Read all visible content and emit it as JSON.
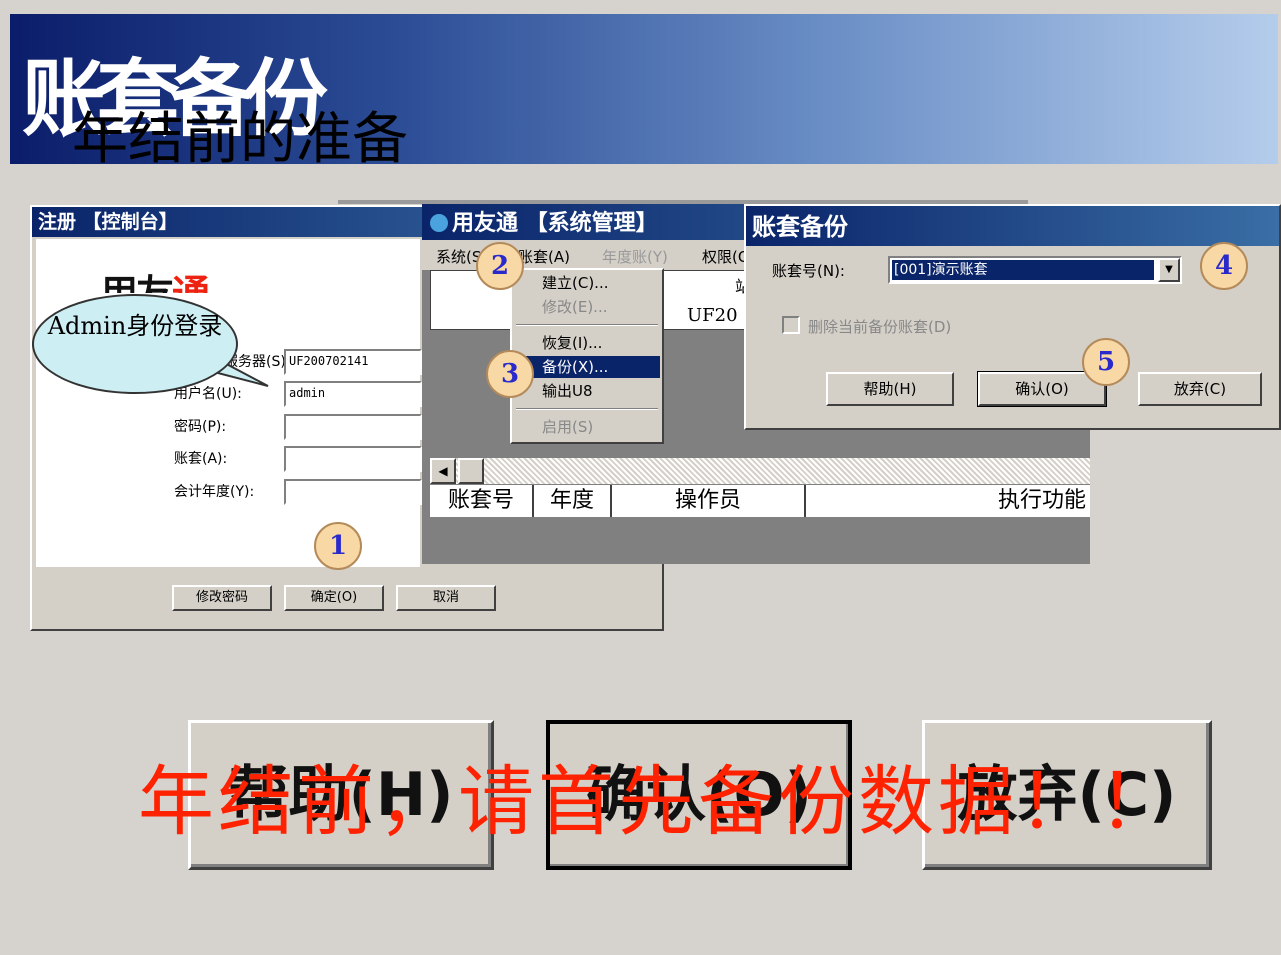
{
  "banner": {
    "title": "账套备份",
    "subtitle": "年结前的准备"
  },
  "login": {
    "title": "注册 【控制台】",
    "logo_prefix": "用友",
    "logo_red": "通",
    "fields": [
      {
        "label": "服务器(S):",
        "value": "UF200702141"
      },
      {
        "label": "用户名(U):",
        "value": "admin"
      },
      {
        "label": "密码(P):",
        "value": ""
      },
      {
        "label": "账套(A):",
        "value": ""
      },
      {
        "label": "会计年度(Y):",
        "value": ""
      }
    ],
    "buttons": {
      "change_password": "修改密码",
      "ok": "确定(O)",
      "cancel": "取消"
    }
  },
  "sysmgr": {
    "title": "用友通 【系统管理】",
    "menu": {
      "system": "系统(S)",
      "account": "账套(A)",
      "year": "年度账(Y)",
      "permission": "权限(O)"
    },
    "grid_cell": "UF20",
    "grid_cell_top": "站",
    "columns": [
      "账套号",
      "年度",
      "操作员",
      "执行功能"
    ]
  },
  "dropdown": {
    "items": [
      {
        "label": "建立(C)...",
        "disabled": false
      },
      {
        "label": "修改(E)...",
        "disabled": true
      },
      {
        "label": "恢复(I)...",
        "disabled": false
      },
      {
        "label": "备份(X)...",
        "disabled": false,
        "selected": true
      },
      {
        "label": "输出U8",
        "disabled": false
      },
      {
        "label": "启用(S)",
        "disabled": true
      }
    ]
  },
  "backup": {
    "title": "账套备份",
    "account_label": "账套号(N):",
    "account_value": "[001]演示账套",
    "delete_label": "删除当前备份账套(D)",
    "buttons": {
      "help": "帮助(H)",
      "confirm": "确认(O)",
      "discard": "放弃(C)"
    }
  },
  "callouts": {
    "bubble": "Admin身份登录",
    "numbers": [
      "1",
      "2",
      "3",
      "4",
      "5"
    ]
  },
  "big_buttons": {
    "help": "帮助(H)",
    "confirm": "确认(O)",
    "discard": "放弃(C)"
  },
  "warning": "年结前，请首先备份数据！！",
  "colors": {
    "banner_dark": "#0b1d6a",
    "banner_light": "#b5cdec",
    "warning": "#ff2200",
    "selection": "#0a246a",
    "callout_fill": "#f8d9a6",
    "bubble_fill": "#cdeff3"
  }
}
